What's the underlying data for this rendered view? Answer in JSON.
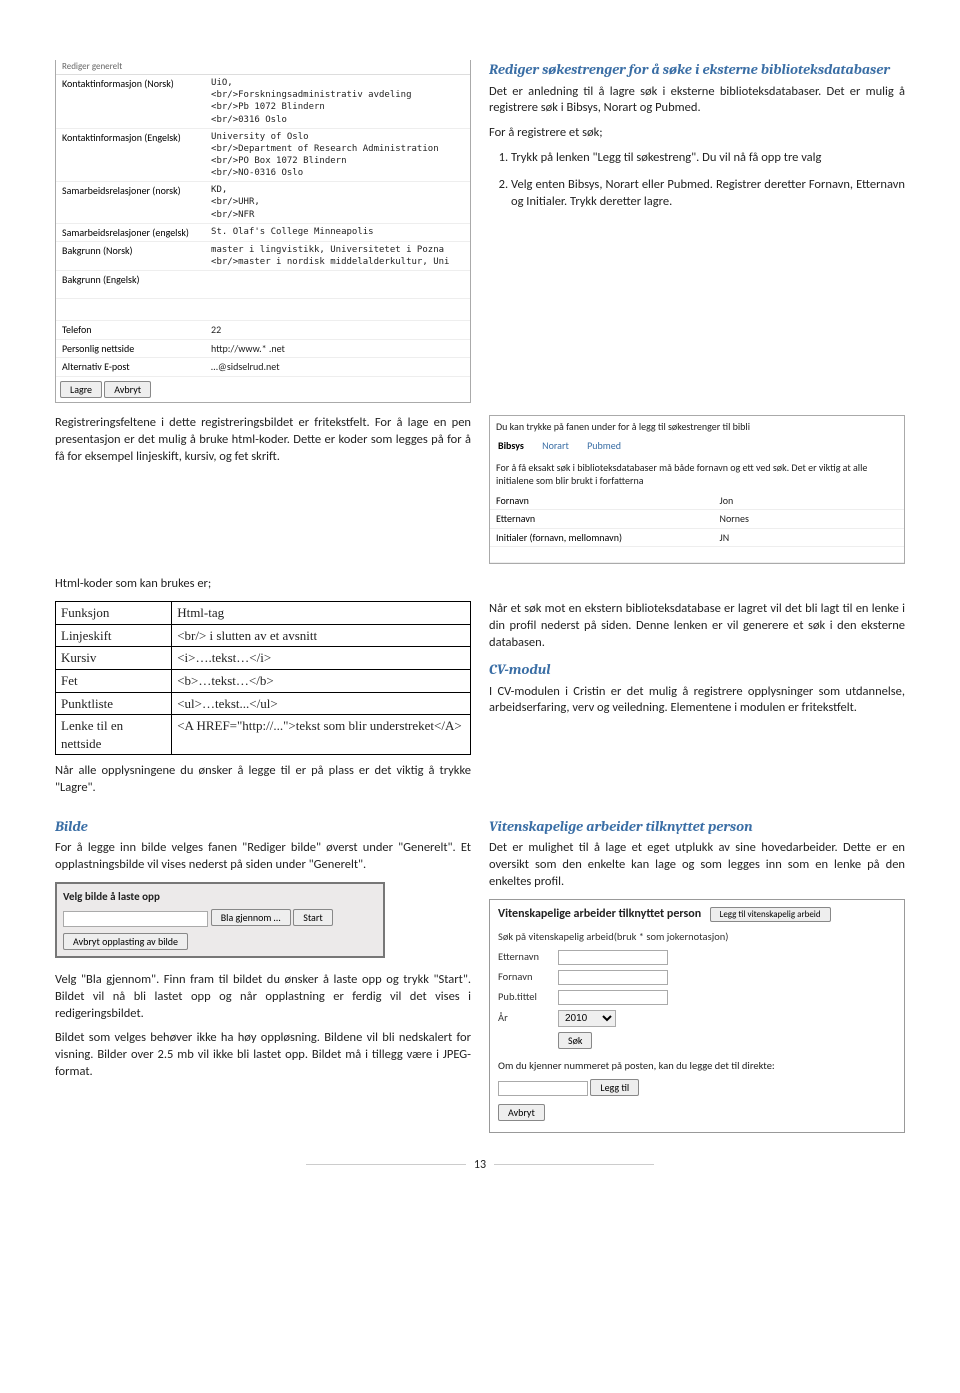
{
  "panel1": {
    "header_cut": "Rediger generelt",
    "rows": [
      {
        "lab": "Kontaktinformasjon (Norsk)",
        "val": "UiO,\n<br/>Forskningsadministrativ avdeling\n<br/>Pb 1072 Blindern\n<br/>0316 Oslo"
      },
      {
        "lab": "Kontaktinformasjon (Engelsk)",
        "val": "University of Oslo\n<br/>Department of Research Administration\n<br/>PO Box 1072 Blindern\n<br/>NO-0316 Oslo"
      },
      {
        "lab": "Samarbeidsrelasjoner (norsk)",
        "val": "KD,\n<br/>UHR,\n<br/>NFR"
      },
      {
        "lab": "Samarbeidsrelasjoner (engelsk)",
        "val": "St. Olaf's College Minneapolis"
      },
      {
        "lab": "Bakgrunn (Norsk)",
        "val": "master i lingvistikk, Universitetet i Pozna\n<br/>master i nordisk middelalderkultur, Uni"
      },
      {
        "lab": "Bakgrunn (Engelsk)",
        "val": ""
      },
      {
        "lab": "",
        "val": ""
      },
      {
        "lab": "Telefon",
        "val": "22"
      },
      {
        "lab": "Personlig nettside",
        "val": "http://www.*            .net"
      },
      {
        "lab": "Alternativ E-post",
        "val": "…@sidselrud.net"
      }
    ],
    "btn_lagre": "Lagre",
    "btn_avbryt": "Avbryt"
  },
  "right_top": {
    "h": "Rediger søkestrenger for å søke i eksterne biblioteksdatabaser",
    "p1": "Det er anledning til å lagre søk i eksterne biblioteksdatabaser. Det er mulig å registrere søk i Bibsys, Norart og Pubmed.",
    "p2": "For å registrere et søk;",
    "li1": "Trykk på lenken \"Legg til søkestreng\". Du vil nå få opp tre valg",
    "li2": "Velg enten Bibsys, Norart eller Pubmed. Registrer deretter Fornavn, Etternavn og Initialer. Trykk deretter lagre."
  },
  "tabpanel": {
    "top": "Du kan trykke på fanen under for å legg til søkestrenger til bibli",
    "t1": "Bibsys",
    "t2": "Norart",
    "t3": "Pubmed",
    "help": "For å få eksakt søk i biblioteksdatabaser må både fornavn og ett ved søk. Det er viktig at alle initialene som blir brukt i forfatterna",
    "f_lab": "Fornavn",
    "f_val": "Jon",
    "e_lab": "Etternavn",
    "e_val": "Nornes",
    "i_lab": "Initialer (fornavn, mellomnavn)",
    "i_val": "JN"
  },
  "leftmid": {
    "p": "Registreringsfeltene i dette registreringsbildet er fritekstfelt. For å lage en pen presentasjon er det mulig å bruke html-koder. Dette er koder som legges på for å få for eksempel linjeskift, kursiv, og fet skrift.",
    "p2": "Html-koder som kan brukes er;"
  },
  "codes": {
    "h1": "Funksjon",
    "h2": "Html-tag",
    "rows": [
      [
        "Linjeskift",
        "<br/> i slutten av et avsnitt"
      ],
      [
        "Kursiv",
        "<i>….tekst…</i>"
      ],
      [
        "Fet",
        "<b>…tekst…</b>"
      ],
      [
        "Punktliste",
        "<ul>…tekst...</ul>"
      ],
      [
        "Lenke til en nettside",
        "<A HREF=\"http://...\">tekst som blir understreket</A>"
      ]
    ],
    "after": "Når alle opplysningene du ønsker å legge til er på plass er det viktig å trykke \"Lagre\"."
  },
  "right_mid": {
    "p": "Når et søk mot en ekstern biblioteksdatabase er lagret vil det bli lagt til en lenke i din profil nederst på siden. Denne lenken er vil generere et søk i den eksterne databasen.",
    "h": "CV-modul",
    "p2": "I CV-modulen i Cristin er det mulig å registrere opplysninger som utdannelse, arbeidserfaring, verv og veiledning. Elementene i modulen er fritekstfelt."
  },
  "bilde": {
    "h": "Bilde",
    "p": "For å legge inn bilde velges fanen \"Rediger bilde\" øverst under \"Generelt\".  Et opplastningsbilde vil vises nederst på siden under \"Generelt\".",
    "panel_title": "Velg bilde å laste opp",
    "btn_browse": "Bla gjennom …",
    "btn_start": "Start",
    "btn_cancel": "Avbryt opplasting av bilde",
    "p_after1": "Velg \"Bla gjennom\". Finn fram til bildet du ønsker å laste opp og trykk \"Start\". Bildet vil nå bli lastet opp og når opplastning er ferdig vil det vises i redigeringsbildet.",
    "p_after2": "Bildet som velges behøver ikke ha høy oppløsning. Bildene vil bli nedskalert for visning. Bilder over 2.5 mb vil ikke bli lastet opp. Bildet må i tillegg være i JPEG-format."
  },
  "vit": {
    "h": "Vitenskapelige arbeider tilknyttet person",
    "p": "Det er mulighet til å lage et eget utplukk av sine hovedarbeider. Dette er en oversikt som den enkelte kan lage og som legges inn som en lenke på den enkeltes profil.",
    "panel_title": "Vitenskapelige arbeider tilknyttet person",
    "btn_add": "Legg til vitenskapelig arbeid",
    "search_h": "Søk på vitenskapelig arbeid(bruk * som jokernotasjon)",
    "f_ett": "Etternavn",
    "f_for": "Fornavn",
    "f_pub": "Pub.tittel",
    "f_ar": "År",
    "ar_val": "2010",
    "btn_sok": "Søk",
    "direct": "Om du kjenner nummeret på posten, kan du legge det til direkte:",
    "btn_legg": "Legg til",
    "btn_avbryt": "Avbryt"
  },
  "page_num": "13"
}
